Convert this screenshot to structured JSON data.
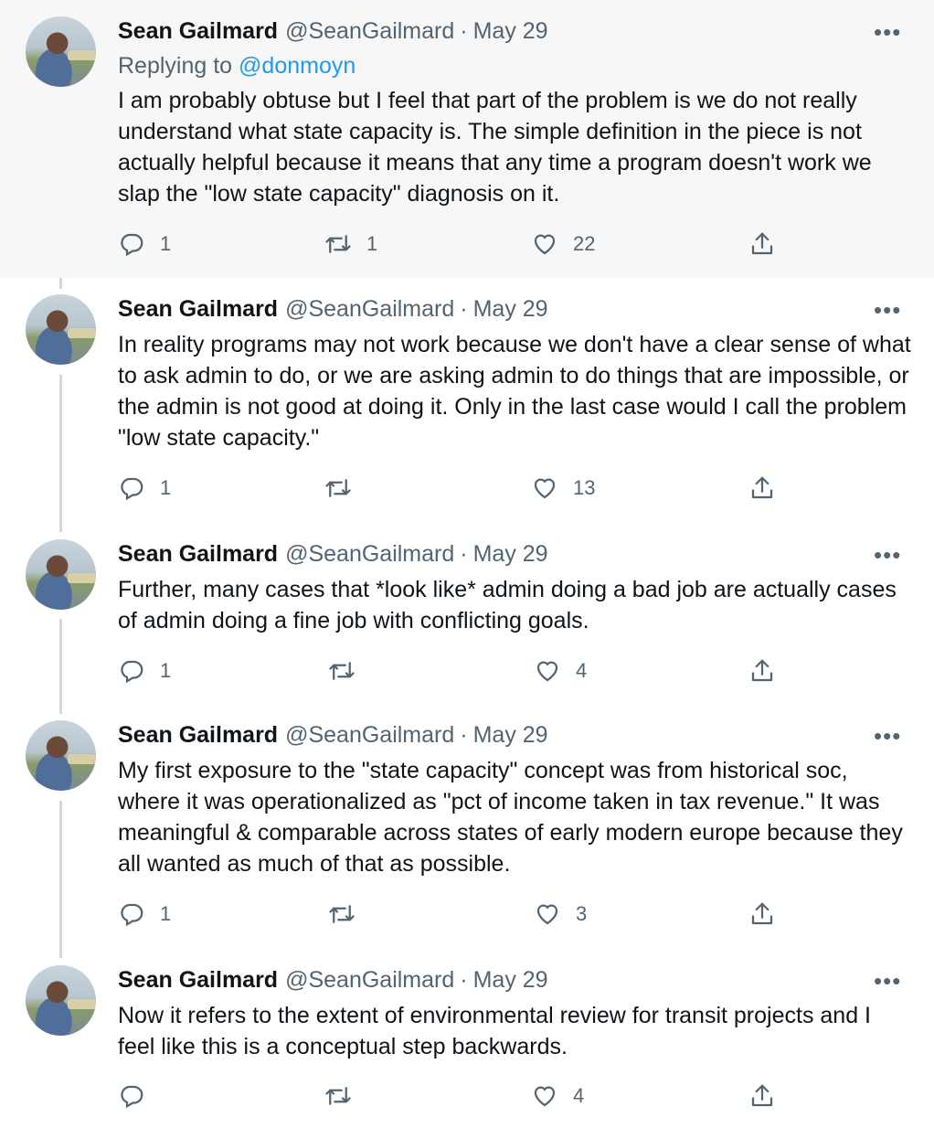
{
  "tweets": [
    {
      "name": "Sean Gailmard",
      "handle": "@SeanGailmard",
      "separator": "·",
      "date": "May 29",
      "more_label": "•••",
      "replying_prefix": "Replying to",
      "replying_to": "@donmoyn",
      "text": "I am probably obtuse but I feel that part of the problem is we do not really understand what state capacity is. The simple definition in the piece is not actually helpful because it means that any time a program doesn't work we slap the \"low state capacity\" diagnosis on it.",
      "replies": "1",
      "retweets": "1",
      "likes": "22"
    },
    {
      "name": "Sean Gailmard",
      "handle": "@SeanGailmard",
      "separator": "·",
      "date": "May 29",
      "more_label": "•••",
      "text": "In reality programs may not work because we don't have a clear sense of what to ask admin to do, or we are asking admin to do things that are impossible, or the admin is not good at doing it. Only in the last case would I call the problem \"low state capacity.\"",
      "replies": "1",
      "retweets": "",
      "likes": "13"
    },
    {
      "name": "Sean Gailmard",
      "handle": "@SeanGailmard",
      "separator": "·",
      "date": "May 29",
      "more_label": "•••",
      "text": "Further, many cases that *look like* admin doing a bad job are actually cases of admin doing a fine job with conflicting goals.",
      "replies": "1",
      "retweets": "",
      "likes": "4"
    },
    {
      "name": "Sean Gailmard",
      "handle": "@SeanGailmard",
      "separator": "·",
      "date": "May 29",
      "more_label": "•••",
      "text": "My first exposure to the \"state capacity\" concept was from historical soc, where it was operationalized as \"pct of income taken in tax revenue.\" It was meaningful & comparable across states of early modern europe because they all wanted as much of that as possible.",
      "replies": "1",
      "retweets": "",
      "likes": "3"
    },
    {
      "name": "Sean Gailmard",
      "handle": "@SeanGailmard",
      "separator": "·",
      "date": "May 29",
      "more_label": "•••",
      "text": "Now it refers to the extent of environmental review for transit projects and I feel like this is a conceptual step backwards.",
      "replies": "",
      "retweets": "",
      "likes": "4"
    }
  ],
  "icons": {
    "reply": "reply-icon",
    "retweet": "retweet-icon",
    "like": "heart-icon",
    "share": "share-icon"
  },
  "colors": {
    "text": "#0f1419",
    "secondary": "#536471",
    "link": "#1d9bf0",
    "thread_line": "#cfd9de",
    "highlight_bg": "#f7f7f7"
  }
}
